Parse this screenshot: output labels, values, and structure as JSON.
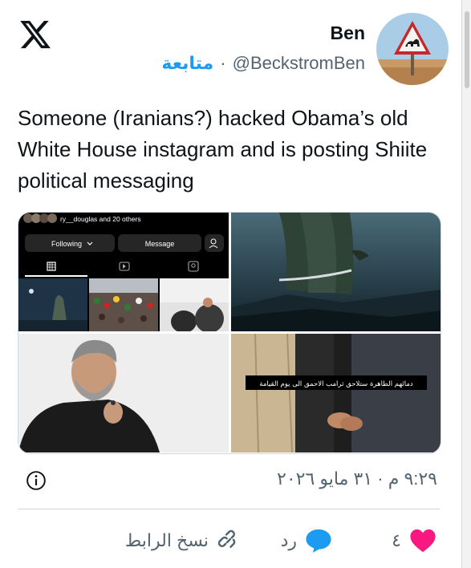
{
  "user": {
    "display_name": "Ben",
    "handle": "@BeckstromBen",
    "separator": "·",
    "follow_label": "متابعة"
  },
  "tweet": {
    "text": "Someone (Iranians?) hacked Obama’s old White House instagram and is posting Shiite political messaging",
    "timestamp": "٩:٢٩ م · ٣١ مايو ٢٠٢٦"
  },
  "media": {
    "instagram": {
      "followers_line": "ry__douglas and 20 others",
      "following_label": "Following",
      "message_label": "Message"
    },
    "caption_overlay": "دمائهم الطاهرة ستلاحق ثرامب الاحمق الى يوم القيامة"
  },
  "actions": {
    "like_count": "٤",
    "reply_label": "رد",
    "copy_link_label": "نسخ الرابط"
  },
  "colors": {
    "accent": "#1d9bf0",
    "like": "#f91880",
    "reply": "#1d9bf0",
    "text_secondary": "#536471",
    "border": "#cfd9de"
  },
  "icons": [
    "x-logo-icon",
    "info-icon",
    "heart-icon",
    "reply-bubble-icon",
    "link-icon"
  ]
}
